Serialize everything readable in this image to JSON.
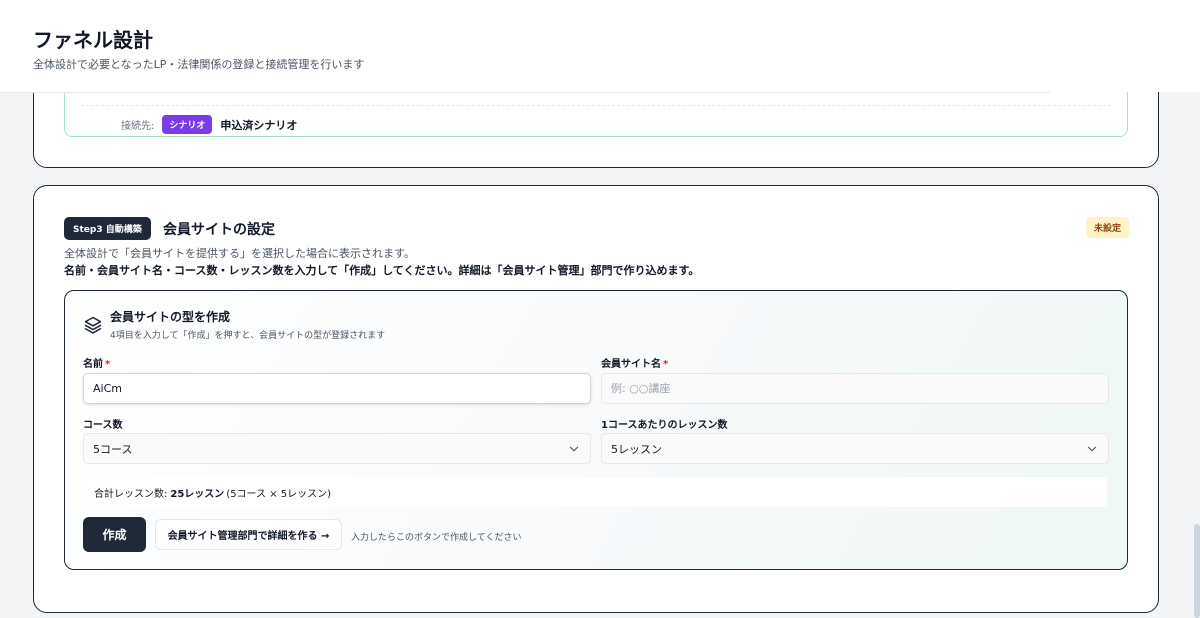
{
  "header": {
    "title": "ファネル設計",
    "subtitle": "全体設計で必要となったLP・法律関係の登録と接続管理を行います"
  },
  "previous_card": {
    "connection_label": "接続先:",
    "tag": "シナリオ",
    "connection_value": "申込済シナリオ"
  },
  "member_site_card": {
    "step_badge": "Step3 自動構築",
    "title": "会員サイトの設定",
    "status": "未設定",
    "description_1": "全体設計で「会員サイトを提供する」を選択した場合に表示されます。",
    "description_2": "名前・会員サイト名・コース数・レッスン数を入力して「作成」してください。詳細は「会員サイト管理」部門で作り込めます。",
    "form": {
      "title": "会員サイトの型を作成",
      "subtitle": "4項目を入力して「作成」を押すと、会員サイトの型が登録されます",
      "name_label": "名前",
      "name_value": "AiCm",
      "site_name_label": "会員サイト名",
      "site_name_placeholder": "例: ○○講座",
      "course_count_label": "コース数",
      "course_count_value": "5コース",
      "lessons_per_course_label": "1コースあたりのレッスン数",
      "lessons_per_course_value": "5レッスン",
      "required_mark": "*",
      "total_label": "合計レッスン数:",
      "total_value": "25レッスン",
      "total_breakdown": "(5コース × 5レッスン)",
      "create_button": "作成",
      "detail_button": "会員サイト管理部門で詳細を作る →",
      "hint": "入力したらこのボタンで作成してください"
    }
  },
  "colors": {
    "dark": "#1f2937",
    "scenario_tag": "#7c3aed",
    "status_bg": "#fef3c7",
    "status_text": "#92400e",
    "required": "#dc2626",
    "connection_border": "#a7e3c5"
  },
  "icons": {
    "form_icon": "layers-icon",
    "select_icon": "chevron-down-icon"
  }
}
